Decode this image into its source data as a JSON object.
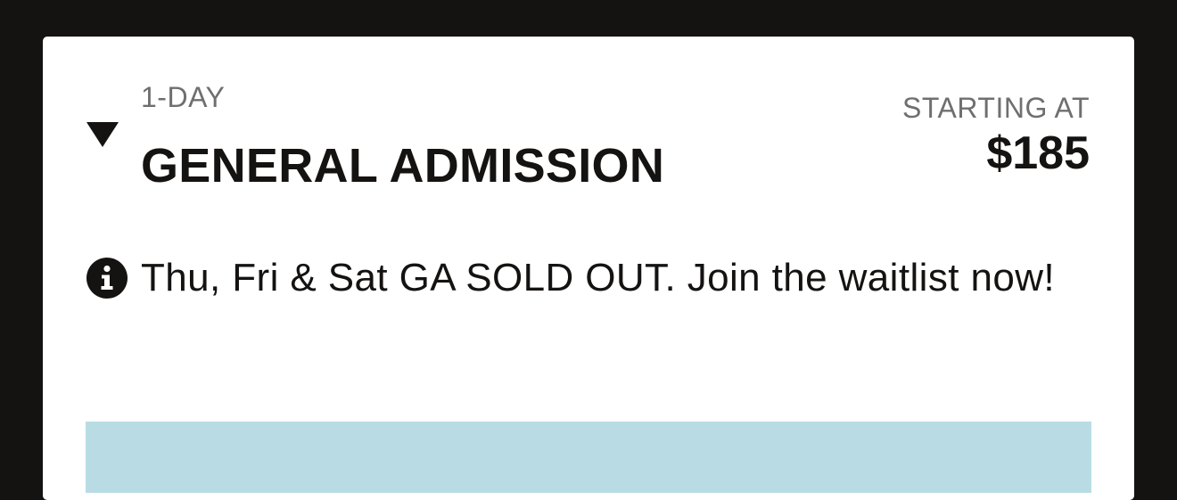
{
  "ticket": {
    "tier": "1-DAY",
    "title": "GENERAL ADMISSION",
    "price_caption": "STARTING AT",
    "price": "$185",
    "expanded": true,
    "toggle_icon": "caret-down-icon"
  },
  "notice": {
    "icon": "info-icon",
    "text": "Thu, Fri & Sat GA SOLD OUT. Join the waitlist now!"
  },
  "colors": {
    "page_background": "#151311",
    "card_background": "#ffffff",
    "muted_text": "#6f6f6f",
    "primary_text": "#151311",
    "banner": "#b9dce4"
  }
}
